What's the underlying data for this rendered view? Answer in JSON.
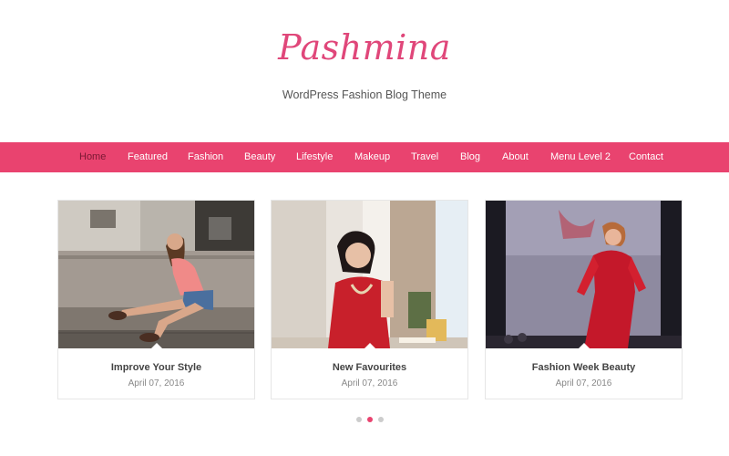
{
  "site": {
    "logo": "Pashmina",
    "tagline": "WordPress Fashion Blog Theme"
  },
  "nav": {
    "items": [
      "Home",
      "Featured",
      "Fashion",
      "Beauty",
      "Lifestyle",
      "Makeup",
      "Travel",
      "Blog",
      "About",
      "Menu Level 2",
      "Contact"
    ],
    "active": "Home"
  },
  "slider": {
    "posts": [
      {
        "title": "Improve Your Style",
        "date": "April 07, 2016"
      },
      {
        "title": "New Favourites",
        "date": "April 07, 2016"
      },
      {
        "title": "Fashion Week Beauty",
        "date": "April 07, 2016"
      }
    ],
    "dots_total": 3,
    "dots_active_index": 1
  },
  "colors": {
    "brand": "#e9436f",
    "logo": "#e0477a",
    "nav_active_text": "#7a1833",
    "dot_inactive": "#cccccc"
  }
}
